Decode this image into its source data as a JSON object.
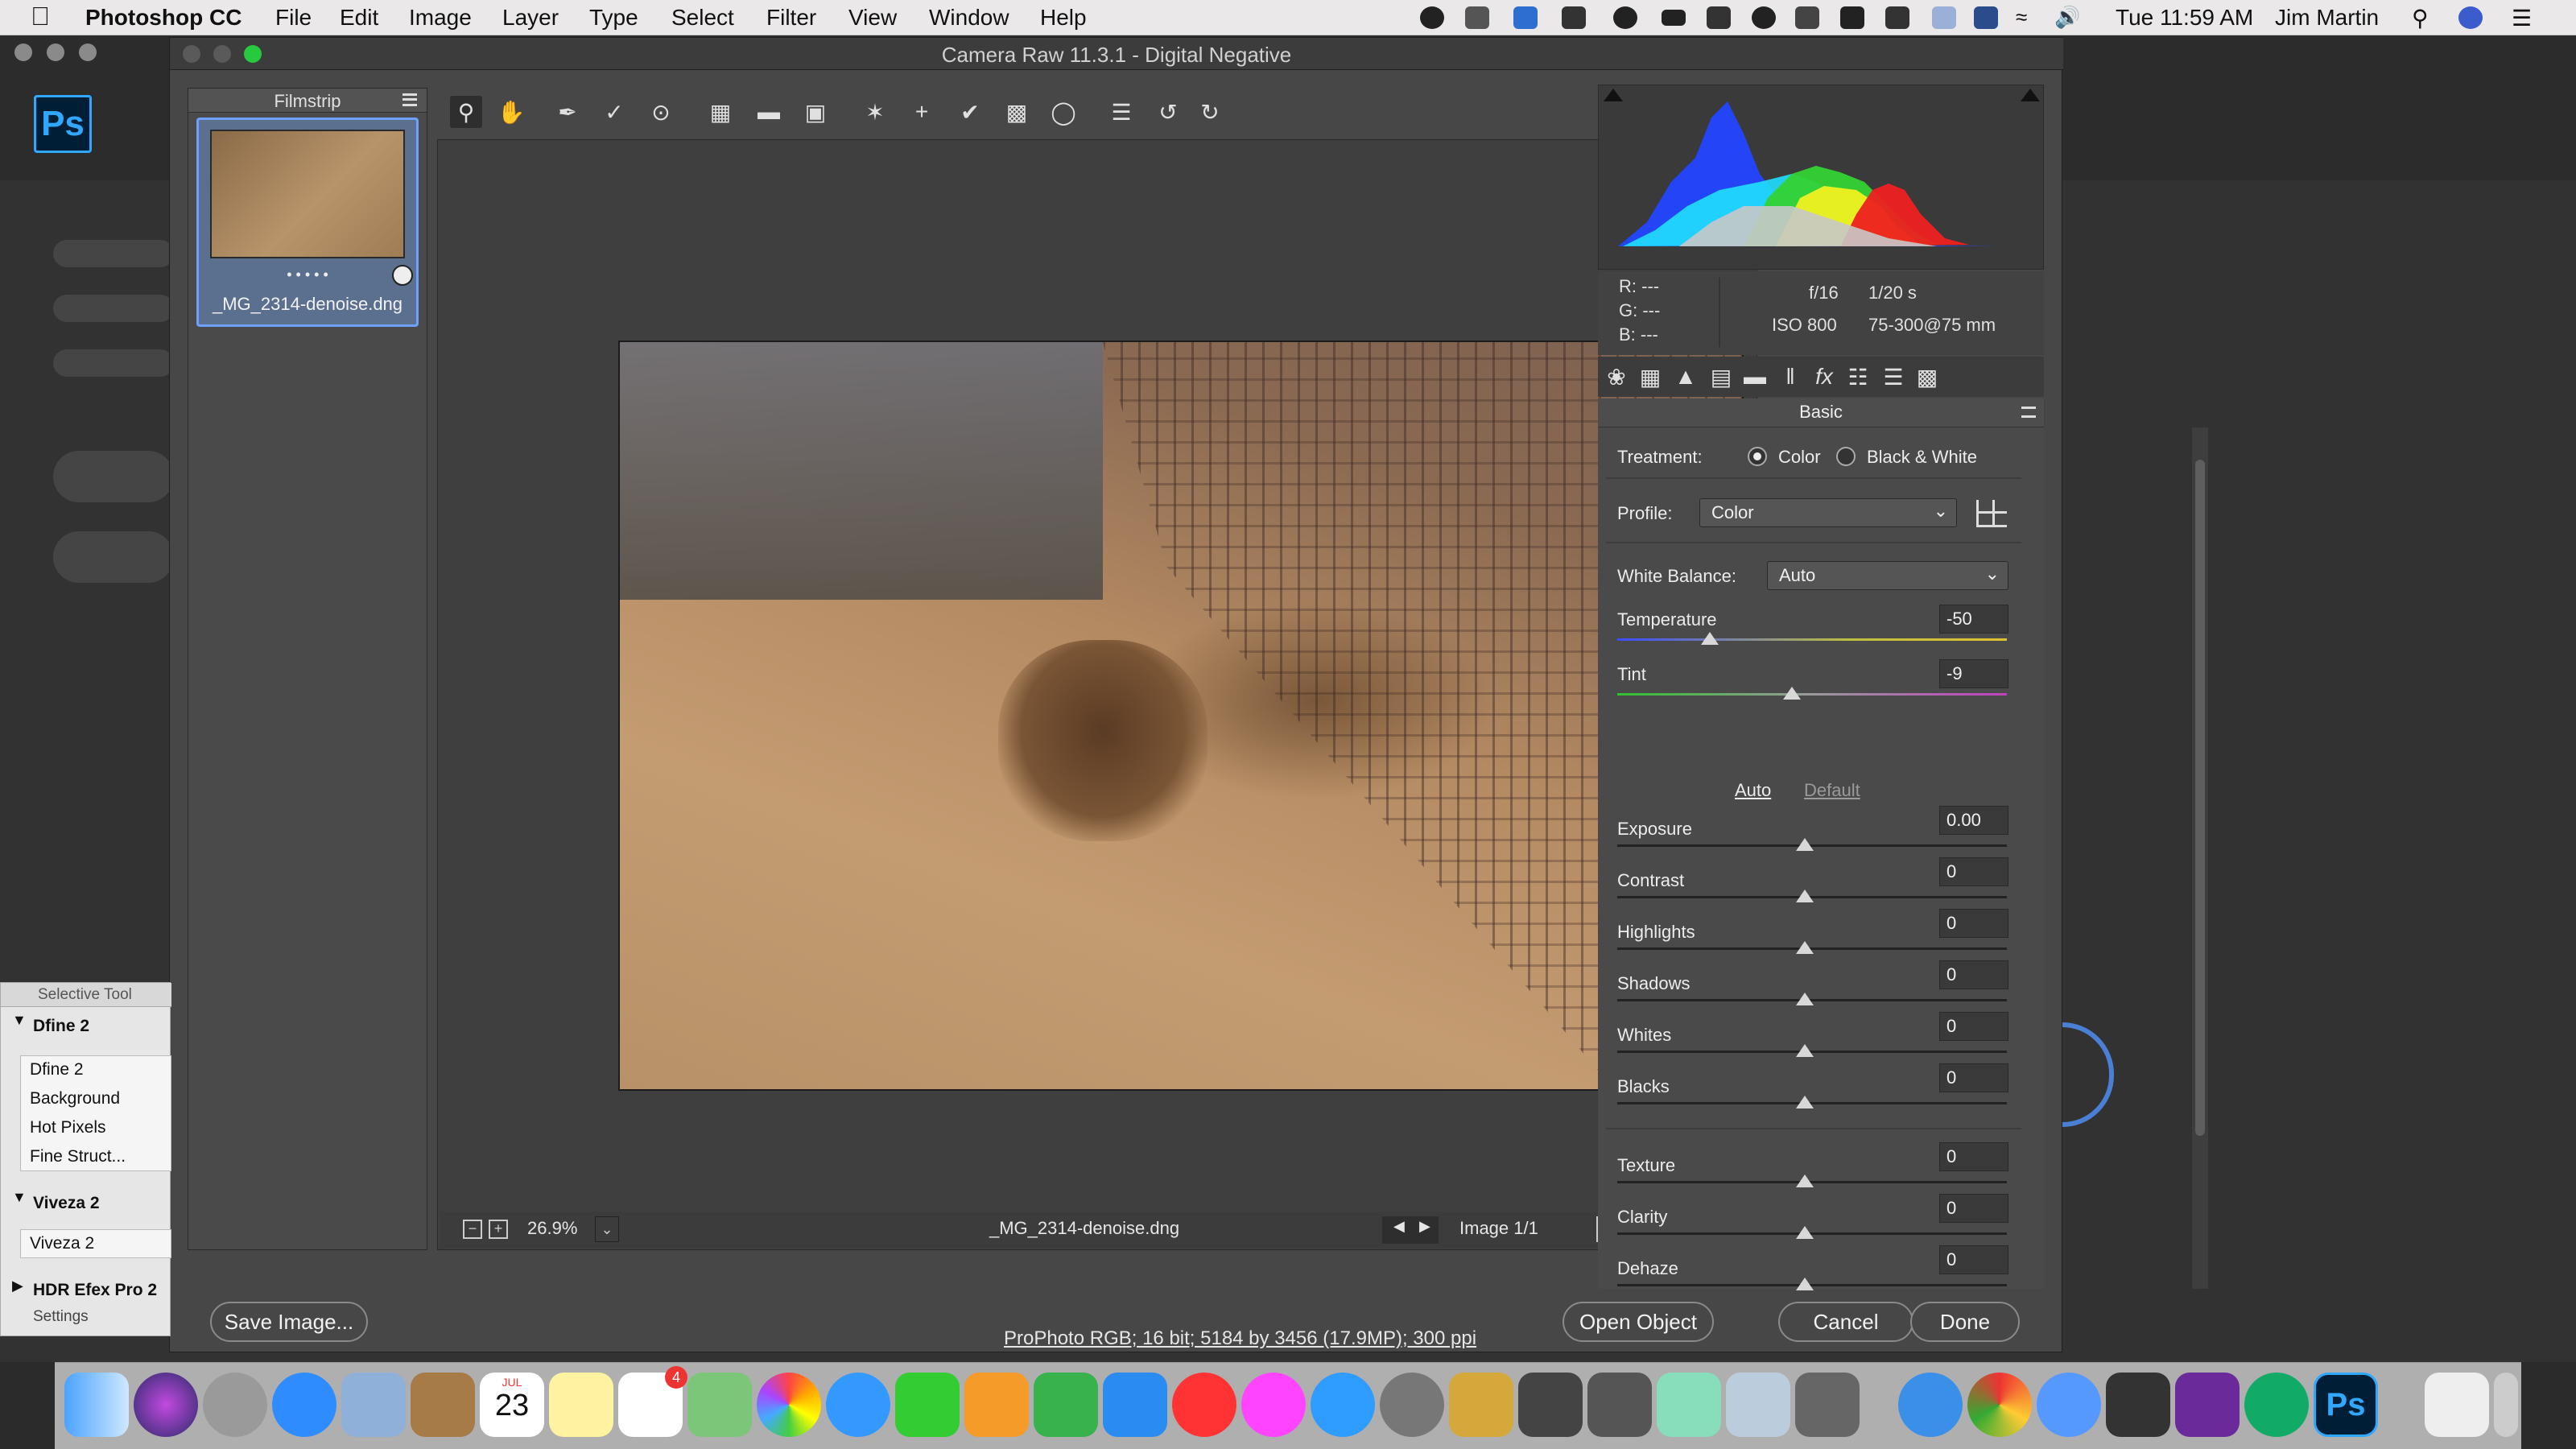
{
  "menubar": {
    "app": "Photoshop CC",
    "items": [
      "File",
      "Edit",
      "Image",
      "Layer",
      "Type",
      "Select",
      "Filter",
      "View",
      "Window",
      "Help"
    ],
    "clock": "Tue 11:59 AM",
    "user": "Jim Martin"
  },
  "window": {
    "title": "Camera Raw 11.3.1  -  Digital Negative"
  },
  "filmstrip": {
    "title": "Filmstrip",
    "filename": "_MG_2314-denoise.dng",
    "dots": "• • • • •"
  },
  "preview": {
    "zoom": "26.9%",
    "filename": "_MG_2314-denoise.dng",
    "counter": "Image 1/1"
  },
  "info": {
    "r": "R:   ---",
    "g": "G:   ---",
    "b": "B:   ---",
    "aperture": "f/16",
    "shutter": "1/20 s",
    "iso": "ISO 800",
    "lens": "75-300@75 mm"
  },
  "panel": {
    "title": "Basic",
    "treatment_label": "Treatment:",
    "treatment_color": "Color",
    "treatment_bw": "Black & White",
    "profile_label": "Profile:",
    "profile_value": "Color",
    "wb_label": "White Balance:",
    "wb_value": "Auto",
    "temperature_label": "Temperature",
    "temperature_value": "-50",
    "tint_label": "Tint",
    "tint_value": "-9",
    "auto": "Auto",
    "default": "Default",
    "sliders": [
      {
        "label": "Exposure",
        "value": "0.00"
      },
      {
        "label": "Contrast",
        "value": "0"
      },
      {
        "label": "Highlights",
        "value": "0"
      },
      {
        "label": "Shadows",
        "value": "0"
      },
      {
        "label": "Whites",
        "value": "0"
      },
      {
        "label": "Blacks",
        "value": "0"
      },
      {
        "label": "Texture",
        "value": "0"
      },
      {
        "label": "Clarity",
        "value": "0"
      },
      {
        "label": "Dehaze",
        "value": "0"
      }
    ]
  },
  "bottom": {
    "save": "Save Image...",
    "workflow": "ProPhoto RGB; 16 bit; 5184 by 3456 (17.9MP); 300 ppi",
    "open": "Open Object",
    "cancel": "Cancel",
    "done": "Done"
  },
  "nik": {
    "title": "Selective Tool",
    "dfine_header": "Dfine 2",
    "items": [
      "Dfine 2",
      "Background",
      "Hot Pixels",
      "Fine Struct..."
    ],
    "viveza_header": "Viveza 2",
    "viveza_item": "Viveza 2",
    "hdr_header": "HDR Efex Pro 2",
    "settings": "Settings"
  },
  "colors": {
    "accent": "#31a8ff",
    "selection": "#6fa0ff",
    "panel": "#4a4a4a"
  },
  "dock_icons": [
    "finder-icon",
    "siri-icon",
    "launchpad-icon",
    "safari-icon",
    "preview-icon",
    "notes-icon",
    "calendar-icon",
    "stickies-icon",
    "reminders-icon",
    "maps-icon",
    "photos-icon",
    "messages-icon",
    "facetime-icon",
    "pages-icon",
    "numbers-icon",
    "keynote-icon",
    "news-icon",
    "itunes-icon",
    "appstore-icon",
    "system-preferences-icon",
    "photoshop-icon",
    "trash-icon"
  ],
  "calendar_day": "23",
  "calendar_month": "JUL",
  "reminders_badge": "4"
}
